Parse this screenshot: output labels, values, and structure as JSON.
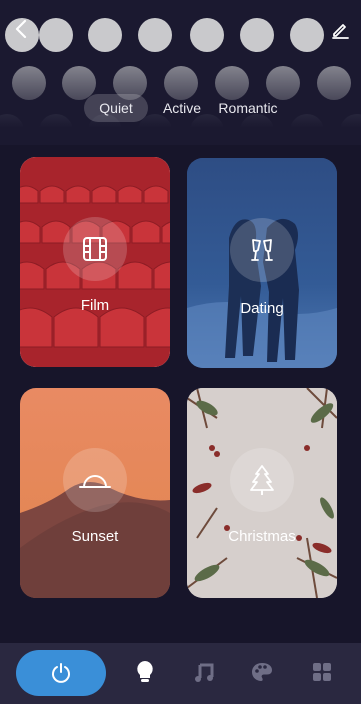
{
  "header": {
    "back_icon": "chevron-left-icon",
    "edit_icon": "pencil-edit-icon"
  },
  "tabs": [
    {
      "label": "Quiet",
      "active": true
    },
    {
      "label": "Active",
      "active": false
    },
    {
      "label": "Romantic",
      "active": false
    }
  ],
  "scenes": [
    {
      "label": "Film",
      "icon": "film-icon",
      "selected": true
    },
    {
      "label": "Dating",
      "icon": "champagne-glasses-icon",
      "selected": false
    },
    {
      "label": "Sunset",
      "icon": "sunset-icon",
      "selected": false
    },
    {
      "label": "Christmas",
      "icon": "christmas-tree-icon",
      "selected": false
    }
  ],
  "bottom_nav": {
    "items": [
      "power-icon",
      "bulb-icon",
      "music-icon",
      "palette-icon",
      "grid-icon"
    ],
    "accent": "#3a8fd8"
  }
}
